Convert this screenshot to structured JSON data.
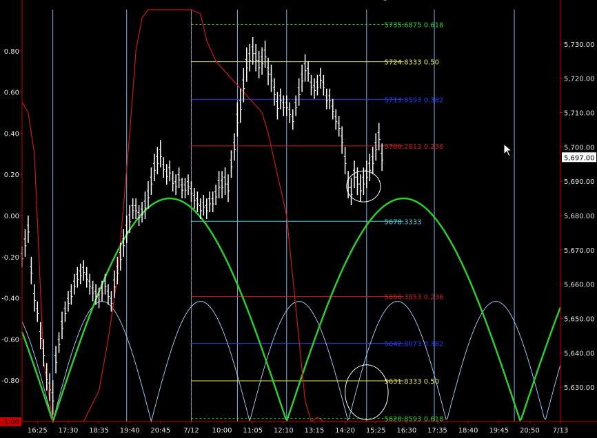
{
  "chart_data": {
    "type": "line",
    "title": "",
    "colors": {
      "background": "#000000",
      "frame": "#cc0000",
      "grid_vertical": "#7fb2e6",
      "price_bars": "#ffffff",
      "oscillator": "#cc1a1a",
      "green_cycle": "#2ecc2e",
      "blue_cycle": "#9fc4ee",
      "fib_yellow": "#e8e85a",
      "fib_blue": "#1f3fff",
      "fib_red": "#cc1a1a",
      "fib_cyan": "#4fd8e8",
      "fib_green": "#2ecc2e",
      "tick_text": "#e6e6e6",
      "price_box": "#ffffff"
    },
    "left_axis": {
      "ticks": [
        "0.80",
        "0.60",
        "0.40",
        "0.20",
        "0.00",
        "-0.20",
        "-0.40",
        "-0.60",
        "-0.80"
      ],
      "ylim": [
        -1.0,
        1.0
      ],
      "current_label": "-1.00"
    },
    "right_axis": {
      "ticks": [
        "5,730.00",
        "5,720.00",
        "5,710.00",
        "5,700.00",
        "5,690.00",
        "5,680.00",
        "5,670.00",
        "5,660.00",
        "5,650.00",
        "5,640.00",
        "5,630.00"
      ],
      "ylim": [
        5620.0,
        5740.0
      ],
      "current_price": "5,697.00"
    },
    "x_axis": {
      "labels": [
        "16:25",
        "17:30",
        "18:35",
        "19:40",
        "20:45",
        "7/12",
        "10:00",
        "11:05",
        "12:10",
        "13:15",
        "14:20",
        "15:25",
        "16:30",
        "17:35",
        "18:40",
        "19:45",
        "20:50",
        "7/13"
      ],
      "label_values": [
        0.5,
        1.5,
        2.5,
        3.5,
        4.5,
        5.5,
        6.5,
        7.5,
        8.5,
        9.5,
        10.5,
        11.5,
        12.5,
        13.5,
        14.5,
        15.5,
        16.5,
        17.5
      ],
      "xlim": [
        0,
        17.5
      ]
    },
    "vertical_lines": [
      1.0,
      3.4,
      5.5,
      7.0,
      8.6,
      11.2,
      13.4,
      16.0
    ],
    "session_divider": 5.5,
    "fib_levels_upper": [
      {
        "label": "5735.6875 0.618",
        "value": 5735.6875,
        "color": "#2ecc2e",
        "dash": true
      },
      {
        "label": "5724.8333 0.50",
        "value": 5724.8333,
        "color": "#e8e85a",
        "dash": false
      },
      {
        "label": "5713.8593 0.382",
        "value": 5713.8593,
        "color": "#1f3fff",
        "dash": false
      },
      {
        "label": "5700.2813 0.236",
        "value": 5700.2813,
        "color": "#cc1a1a",
        "dash": false
      }
    ],
    "fib_mid": {
      "label": "5678.3333",
      "value": 5678.3333,
      "color": "#4fd8e8"
    },
    "fib_levels_lower": [
      {
        "label": "5656.3853 0.236",
        "value": 5656.3853,
        "color": "#cc1a1a",
        "dash": false
      },
      {
        "label": "5642.8073 0.382",
        "value": 5642.8073,
        "color": "#1f3fff",
        "dash": false
      },
      {
        "label": "5631.8333 0.50",
        "value": 5631.8333,
        "color": "#e8e85a",
        "dash": false
      },
      {
        "label": "5620.8593 0.618",
        "value": 5620.8593,
        "color": "#2ecc2e",
        "dash": true
      }
    ],
    "fib_x_range": [
      5.5,
      12.4
    ],
    "price_series": {
      "name": "",
      "x": [
        0.0,
        0.1,
        0.2,
        0.3,
        0.4,
        0.5,
        0.6,
        0.7,
        0.8,
        0.9,
        1.0,
        1.1,
        1.2,
        1.3,
        1.4,
        1.5,
        1.6,
        1.7,
        1.8,
        1.9,
        2.0,
        2.1,
        2.2,
        2.3,
        2.4,
        2.5,
        2.6,
        2.7,
        2.8,
        2.9,
        3.0,
        3.1,
        3.2,
        3.3,
        3.4,
        3.5,
        3.6,
        3.7,
        3.8,
        3.9,
        4.0,
        4.1,
        4.2,
        4.3,
        4.4,
        4.5,
        4.6,
        4.7,
        4.8,
        4.9,
        5.0,
        5.1,
        5.2,
        5.3,
        5.4,
        5.5,
        5.6,
        5.7,
        5.8,
        5.9,
        6.0,
        6.1,
        6.2,
        6.3,
        6.4,
        6.5,
        6.6,
        6.7,
        6.8,
        6.9,
        7.0,
        7.1,
        7.2,
        7.3,
        7.4,
        7.5,
        7.6,
        7.7,
        7.8,
        7.9,
        8.0,
        8.1,
        8.2,
        8.3,
        8.4,
        8.5,
        8.6,
        8.7,
        8.8,
        8.9,
        9.0,
        9.1,
        9.2,
        9.3,
        9.4,
        9.5,
        9.6,
        9.7,
        9.8,
        9.9,
        10.0,
        10.1,
        10.2,
        10.3,
        10.4,
        10.5,
        10.6,
        10.7,
        10.8,
        10.9,
        11.0,
        11.1,
        11.2,
        11.3,
        11.4,
        11.5,
        11.6,
        11.7,
        11.8
      ],
      "values": [
        5668,
        5672,
        5676,
        5664,
        5656,
        5652,
        5645,
        5640,
        5633,
        5630,
        5627,
        5638,
        5643,
        5648,
        5652,
        5655,
        5657,
        5660,
        5662,
        5663,
        5664,
        5662,
        5660,
        5658,
        5657,
        5656,
        5658,
        5660,
        5657,
        5655,
        5660,
        5664,
        5668,
        5672,
        5676,
        5679,
        5682,
        5682,
        5680,
        5681,
        5683,
        5686,
        5690,
        5694,
        5696,
        5698,
        5694,
        5692,
        5693,
        5690,
        5689,
        5691,
        5688,
        5688,
        5689,
        5687,
        5685,
        5684,
        5682,
        5683,
        5682,
        5684,
        5684,
        5686,
        5689,
        5689,
        5690,
        5688,
        5695,
        5700,
        5708,
        5712,
        5718,
        5724,
        5726,
        5728,
        5726,
        5724,
        5725,
        5727,
        5722,
        5720,
        5716,
        5712,
        5714,
        5712,
        5712,
        5710,
        5708,
        5712,
        5716,
        5720,
        5723,
        5722,
        5718,
        5717,
        5718,
        5720,
        5718,
        5714,
        5714,
        5711,
        5708,
        5706,
        5702,
        5696,
        5689,
        5687,
        5692,
        5690,
        5688,
        5690,
        5692,
        5694,
        5696,
        5700,
        5703,
        5697
      ],
      "ranges": [
        3,
        4,
        4,
        4,
        4,
        3,
        4,
        4,
        4,
        4,
        5,
        4,
        3,
        4,
        3,
        3,
        3,
        3,
        3,
        3,
        3,
        3,
        3,
        3,
        3,
        3,
        3,
        3,
        3,
        3,
        4,
        4,
        4,
        4,
        4,
        4,
        3,
        3,
        3,
        3,
        4,
        4,
        4,
        4,
        4,
        4,
        3,
        3,
        3,
        3,
        3,
        3,
        3,
        3,
        3,
        3,
        3,
        3,
        3,
        3,
        3,
        3,
        3,
        3,
        4,
        4,
        4,
        4,
        4,
        4,
        5,
        5,
        5,
        5,
        4,
        4,
        4,
        4,
        4,
        4,
        4,
        4,
        4,
        4,
        3,
        3,
        3,
        3,
        3,
        3,
        4,
        4,
        4,
        3,
        3,
        3,
        3,
        3,
        3,
        3,
        3,
        3,
        3,
        3,
        4,
        4,
        4,
        4,
        4,
        4,
        4,
        4,
        4,
        4,
        4,
        4,
        4,
        4,
        4
      ]
    },
    "oscillator_series": {
      "x": [
        0.0,
        0.2,
        0.4,
        0.7,
        1.0,
        1.5,
        2.0,
        2.5,
        2.8,
        3.1,
        3.3,
        3.5,
        3.7,
        3.9,
        4.1,
        4.4,
        4.8,
        5.3,
        5.5,
        5.8,
        6.0,
        6.3,
        6.6,
        6.9,
        7.2,
        7.5,
        7.8,
        8.0,
        8.3,
        8.6,
        8.8,
        9.0,
        9.2,
        9.4,
        9.6,
        9.8,
        10.0,
        10.5,
        11.0,
        11.2,
        11.5,
        12.0
      ],
      "values": [
        0.55,
        0.5,
        0.3,
        -0.7,
        -1.0,
        -1.0,
        -1.0,
        -0.85,
        -0.6,
        -0.3,
        0.05,
        0.4,
        0.8,
        0.96,
        1.0,
        1.0,
        1.0,
        1.0,
        1.0,
        0.98,
        0.85,
        0.75,
        0.7,
        0.65,
        0.6,
        0.55,
        0.5,
        0.4,
        0.2,
        0.0,
        -0.3,
        -0.6,
        -0.9,
        -1.0,
        -0.98,
        -1.0,
        -1.0,
        -1.0,
        -1.0,
        -1.0,
        -1.0,
        -1.0
      ]
    },
    "green_cycle": {
      "period": 7.6,
      "first_zero": 1.0,
      "ylim": [
        5620,
        5685
      ],
      "xlim": [
        0,
        17.5
      ]
    },
    "blue_cycle": {
      "period": 3.2,
      "first_zero": 1.0,
      "ylim": [
        5620,
        5655
      ],
      "xlim": [
        0,
        17.5
      ]
    },
    "ellipses": [
      {
        "cx": 11.1,
        "cy": 5688.5,
        "rx": 0.55,
        "ry": 4.5
      },
      {
        "cx": 11.2,
        "cy": 5628.5,
        "rx": 0.7,
        "ry": 8.0
      }
    ]
  }
}
